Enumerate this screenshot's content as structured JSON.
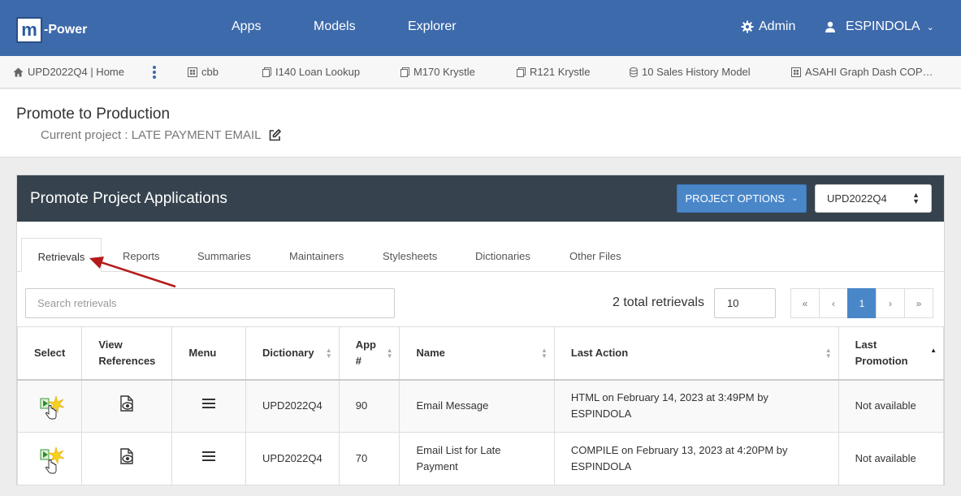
{
  "nav": {
    "logo_letter": "m",
    "logo_text": "-Power",
    "links": [
      "Apps",
      "Models",
      "Explorer"
    ],
    "admin": "Admin",
    "user": "ESPINDOLA"
  },
  "workspace_tabs": [
    {
      "label": "UPD2022Q4 | Home",
      "icon": "home-icon"
    },
    {
      "label": "cbb",
      "icon": "grid-icon"
    },
    {
      "label": "I140 Loan Lookup",
      "icon": "copy-icon"
    },
    {
      "label": "M170 Krystle",
      "icon": "copy-icon"
    },
    {
      "label": "R121 Krystle",
      "icon": "copy-icon"
    },
    {
      "label": "10 Sales History Model",
      "icon": "database-icon"
    },
    {
      "label": "ASAHI Graph Dash COP…",
      "icon": "grid-icon"
    }
  ],
  "page": {
    "title": "Promote to Production",
    "current_project": "Current project : LATE PAYMENT EMAIL"
  },
  "panel": {
    "title": "Promote Project Applications",
    "project_options": "PROJECT OPTIONS",
    "library": "UPD2022Q4",
    "tabs": [
      "Retrievals",
      "Reports",
      "Summaries",
      "Maintainers",
      "Stylesheets",
      "Dictionaries",
      "Other Files"
    ],
    "active_tab": "Retrievals",
    "search_placeholder": "Search retrievals",
    "total": "2 total retrievals",
    "page_size": "10",
    "pager": {
      "first": "«",
      "prev": "‹",
      "current": "1",
      "next": "›",
      "last": "»"
    }
  },
  "table": {
    "headers": {
      "select": "Select",
      "view_refs_1": "View",
      "view_refs_2": "References",
      "menu": "Menu",
      "dictionary": "Dictionary",
      "app": "App #",
      "name": "Name",
      "last_action": "Last Action",
      "last_promo_1": "Last",
      "last_promo_2": "Promotion"
    },
    "rows": [
      {
        "dictionary": "UPD2022Q4",
        "app": "90",
        "name_1": "Email Message",
        "name_2": "",
        "action_1": "HTML on February 14, 2023 at 3:49PM by ESPINDOLA",
        "action_2": "",
        "promotion": "Not available"
      },
      {
        "dictionary": "UPD2022Q4",
        "app": "70",
        "name_1": "Email List for Late",
        "name_2": "Payment",
        "action_1": "COMPILE on February 13, 2023 at 4:20PM by",
        "action_2": "ESPINDOLA",
        "promotion": "Not available"
      }
    ]
  },
  "colors": {
    "nav": "#3d6aab",
    "panel_head": "#36434e",
    "accent": "#4a87c9",
    "annotation_arrow": "#b51a1a"
  }
}
